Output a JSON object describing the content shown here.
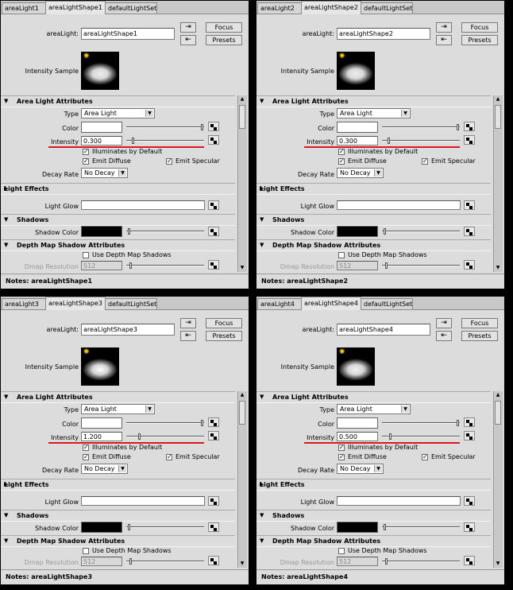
{
  "panels": [
    {
      "tabs": [
        "areaLight1",
        "areaLightShape1",
        "defaultLightSet"
      ],
      "active_tab": 1,
      "node_label": "areaLight:",
      "node_value": "areaLightShape1",
      "focus": "Focus",
      "presets": "Presets",
      "sample_label": "Intensity Sample",
      "sample_glow": 0.3,
      "attr_section": "Area Light Attributes",
      "type_label": "Type",
      "type_value": "Area Light",
      "color_label": "Color",
      "intensity_label": "Intensity",
      "intensity_value": "0.300",
      "intensity_slider": 0.03,
      "illum": "Illuminates by Default",
      "diffuse": "Emit Diffuse",
      "specular": "Emit Specular",
      "decay_label": "Decay Rate",
      "decay_value": "No Decay",
      "effects_section": "Light Effects",
      "glow_label": "Light Glow",
      "shadows_section": "Shadows",
      "shadow_color_label": "Shadow Color",
      "depth_section": "Depth Map Shadow Attributes",
      "use_depth": "Use Depth Map Shadows",
      "dmap_label": "Dmap Resolution",
      "dmap_value": "512",
      "notes": "Notes:  areaLightShape1"
    },
    {
      "tabs": [
        "areaLight2",
        "areaLightShape2",
        "defaultLightSet"
      ],
      "active_tab": 1,
      "node_label": "areaLight:",
      "node_value": "areaLightShape2",
      "focus": "Focus",
      "presets": "Presets",
      "sample_label": "Intensity Sample",
      "sample_glow": 0.3,
      "attr_section": "Area Light Attributes",
      "type_label": "Type",
      "type_value": "Area Light",
      "color_label": "Color",
      "intensity_label": "Intensity",
      "intensity_value": "0.300",
      "intensity_slider": 0.03,
      "illum": "Illuminates by Default",
      "diffuse": "Emit Diffuse",
      "specular": "Emit Specular",
      "decay_label": "Decay Rate",
      "decay_value": "No Decay",
      "effects_section": "Light Effects",
      "glow_label": "Light Glow",
      "shadows_section": "Shadows",
      "shadow_color_label": "Shadow Color",
      "depth_section": "Depth Map Shadow Attributes",
      "use_depth": "Use Depth Map Shadows",
      "dmap_label": "Dmap Resolution",
      "dmap_value": "512",
      "notes": "Notes:  areaLightShape2"
    },
    {
      "tabs": [
        "areaLight3",
        "areaLightShape3",
        "defaultLightSet"
      ],
      "active_tab": 1,
      "node_label": "areaLight:",
      "node_value": "areaLightShape3",
      "focus": "Focus",
      "presets": "Presets",
      "sample_label": "Intensity Sample",
      "sample_glow": 1.0,
      "attr_section": "Area Light Attributes",
      "type_label": "Type",
      "type_value": "Area Light",
      "color_label": "Color",
      "intensity_label": "Intensity",
      "intensity_value": "1.200",
      "intensity_slider": 0.12,
      "illum": "Illuminates by Default",
      "diffuse": "Emit Diffuse",
      "specular": "Emit Specular",
      "decay_label": "Decay Rate",
      "decay_value": "No Decay",
      "effects_section": "Light Effects",
      "glow_label": "Light Glow",
      "shadows_section": "Shadows",
      "shadow_color_label": "Shadow Color",
      "depth_section": "Depth Map Shadow Attributes",
      "use_depth": "Use Depth Map Shadows",
      "dmap_label": "Dmap Resolution",
      "dmap_value": "512",
      "notes": "Notes:  areaLightShape3"
    },
    {
      "tabs": [
        "areaLight4",
        "areaLightShape4",
        "defaultLightSet"
      ],
      "active_tab": 1,
      "node_label": "areaLight:",
      "node_value": "areaLightShape4",
      "focus": "Focus",
      "presets": "Presets",
      "sample_label": "Intensity Sample",
      "sample_glow": 0.5,
      "attr_section": "Area Light Attributes",
      "type_label": "Type",
      "type_value": "Area Light",
      "color_label": "Color",
      "intensity_label": "Intensity",
      "intensity_value": "0.500",
      "intensity_slider": 0.05,
      "illum": "Illuminates by Default",
      "diffuse": "Emit Diffuse",
      "specular": "Emit Specular",
      "decay_label": "Decay Rate",
      "decay_value": "No Decay",
      "effects_section": "Light Effects",
      "glow_label": "Light Glow",
      "shadows_section": "Shadows",
      "shadow_color_label": "Shadow Color",
      "depth_section": "Depth Map Shadow Attributes",
      "use_depth": "Use Depth Map Shadows",
      "dmap_label": "Dmap Resolution",
      "dmap_value": "512",
      "notes": "Notes:  areaLightShape4"
    }
  ],
  "icons": {
    "focus_input": "input-connection-icon",
    "focus_output": "output-connection-icon",
    "map": "map-button-icon",
    "bulb": "light-bulb-icon"
  },
  "colors": {
    "highlight_line": "#e0161d",
    "shadow_color": "#000000",
    "light_color": "#ffffff"
  }
}
